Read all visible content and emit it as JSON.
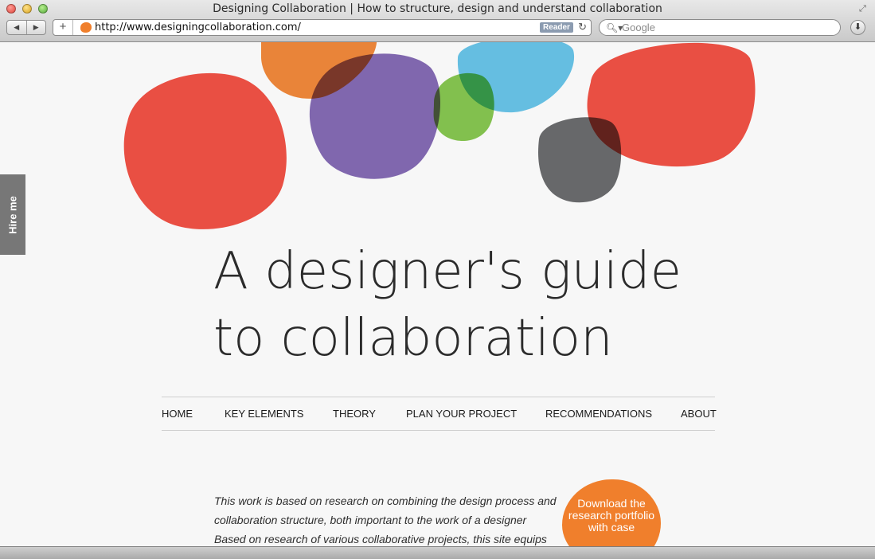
{
  "window": {
    "title": "Designing Collaboration | How to structure, design and understand collaboration"
  },
  "toolbar": {
    "back_icon": "back-arrow-icon",
    "forward_icon": "forward-arrow-icon",
    "add_icon": "plus-icon",
    "url": "http://www.designingcollaboration.com/",
    "reader_label": "Reader",
    "search_placeholder": "Google"
  },
  "page": {
    "hire_label": "Hire me",
    "headline": {
      "line1": "A designer's guide",
      "line2": "to collaboration"
    },
    "nav": [
      "HOME",
      "KEY ELEMENTS",
      "THEORY",
      "PLAN YOUR PROJECT",
      "RECOMMENDATIONS",
      "ABOUT"
    ],
    "intro_text": "This work is based on research on combining the design process and collaboration structure, both important to the work of a designer Based on research of various collaborative projects, this site equips you with a theory and a practical structure for your",
    "cta_label": "Download the research portfolio with case"
  },
  "colors": {
    "red": "#f04437",
    "orange": "#f07f2c",
    "purple": "#7b5fae",
    "blue": "#5cc0e8",
    "green": "#7dc242",
    "gray": "#5f6062",
    "hire_bg": "#777777"
  }
}
